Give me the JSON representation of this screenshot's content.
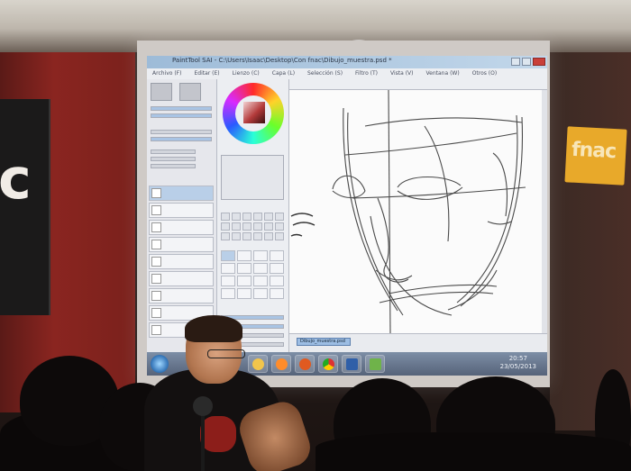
{
  "scene": {
    "left_sign_text": "c",
    "right_badge_text": "fnac"
  },
  "app": {
    "title": "PaintTool SAI - C:\\Users\\Isaac\\Desktop\\Con fnac\\Dibujo_muestra.psd *",
    "menu": [
      "Archivo (F)",
      "Editar (E)",
      "Lienzo (C)",
      "Capa (L)",
      "Selección (S)",
      "Filtro (T)",
      "Vista (V)",
      "Ventana (W)",
      "Otros (O)"
    ],
    "file_tab": "Dibujo_muestra.psd"
  },
  "taskbar": {
    "time": "20:57",
    "date": "23/05/2013"
  },
  "colors": {
    "screen_frame": "#cfcac6",
    "taskbar": "#566379",
    "fnac_yellow": "#e8a92a",
    "wall_red": "#8a2520"
  }
}
